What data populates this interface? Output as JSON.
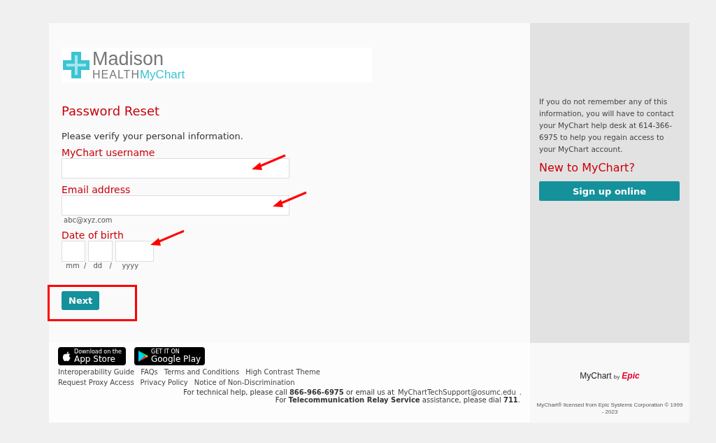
{
  "logo": {
    "name": "Madison",
    "sub": "HEALTH",
    "brand": "MyChart"
  },
  "title": "Password Reset",
  "intro": "Please verify your personal information.",
  "fields": [
    {
      "kind": "text",
      "label": "MyChart username",
      "annotated": true
    },
    {
      "kind": "text",
      "label": "Email address",
      "hint": "abc@xyz.com",
      "annotated": true
    },
    {
      "kind": "date",
      "label": "Date of birth",
      "parts": [
        "mm",
        "dd",
        "yyyy"
      ],
      "separator": "/",
      "annotated": true
    }
  ],
  "next_button": {
    "label": "Next",
    "highlighted": true
  },
  "sidebar": {
    "info": "If you do not remember any of this information, you will have to contact your MyChart help desk at 614-366-6975 to help you regain access to your MyChart account.",
    "heading": "New to MyChart?",
    "button": "Sign up online"
  },
  "footer": {
    "badges": [
      {
        "kind": "apple",
        "small": "Download on the",
        "big": "App Store"
      },
      {
        "kind": "google",
        "small": "GET IT ON",
        "big": "Google Play"
      }
    ],
    "link_rows": [
      [
        "Interoperability Guide",
        "FAQs",
        "Terms and Conditions",
        "High Contrast Theme"
      ],
      [
        "Request Proxy Access",
        "Privacy Policy",
        "Notice of Non-Discrimination"
      ]
    ],
    "help": "For technical help, please call **866-966-6975** or email us at",
    "email": "MyChartTechSupport@osumc.edu",
    "help_end": ".",
    "relay": "For **Telecommunication Relay Service** assistance, please dial **711**.",
    "epic_logo": {
      "name": "MyChart",
      "by": "by",
      "brand": "Epic"
    },
    "license": "MyChart® licensed from Epic Systems Corporation © 1999 - 2023"
  }
}
